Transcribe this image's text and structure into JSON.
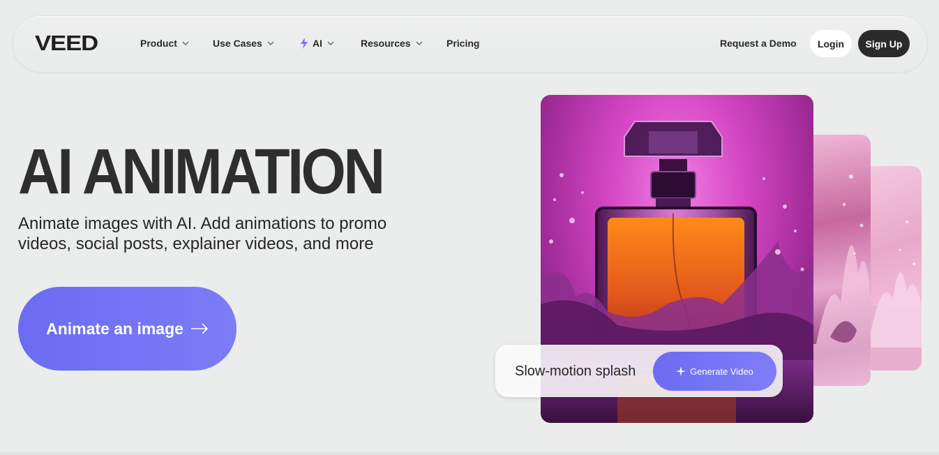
{
  "brand": {
    "logo_text": "VEED"
  },
  "nav": {
    "items": [
      {
        "label": "Product",
        "has_dropdown": true
      },
      {
        "label": "Use Cases",
        "has_dropdown": true
      },
      {
        "label": "AI",
        "has_dropdown": true,
        "icon": "lightning-icon"
      },
      {
        "label": "Resources",
        "has_dropdown": true
      },
      {
        "label": "Pricing",
        "has_dropdown": false
      }
    ],
    "request_demo": "Request a Demo",
    "login": "Login",
    "signup": "Sign Up"
  },
  "hero": {
    "title": "AI ANIMATION",
    "subtitle": "Animate images with AI. Add animations to promo videos, social posts, explainer videos, and more",
    "cta_label": "Animate an image",
    "cta_icon": "arrow-right-icon"
  },
  "showcase": {
    "prompt_text": "Slow-motion splash",
    "generate_label": "Generate Video",
    "generate_icon": "sparkle-icon"
  },
  "colors": {
    "accent": "#6d6cf2",
    "text": "#262626",
    "background": "#ebecec",
    "signup_bg": "#2b2b2b"
  }
}
